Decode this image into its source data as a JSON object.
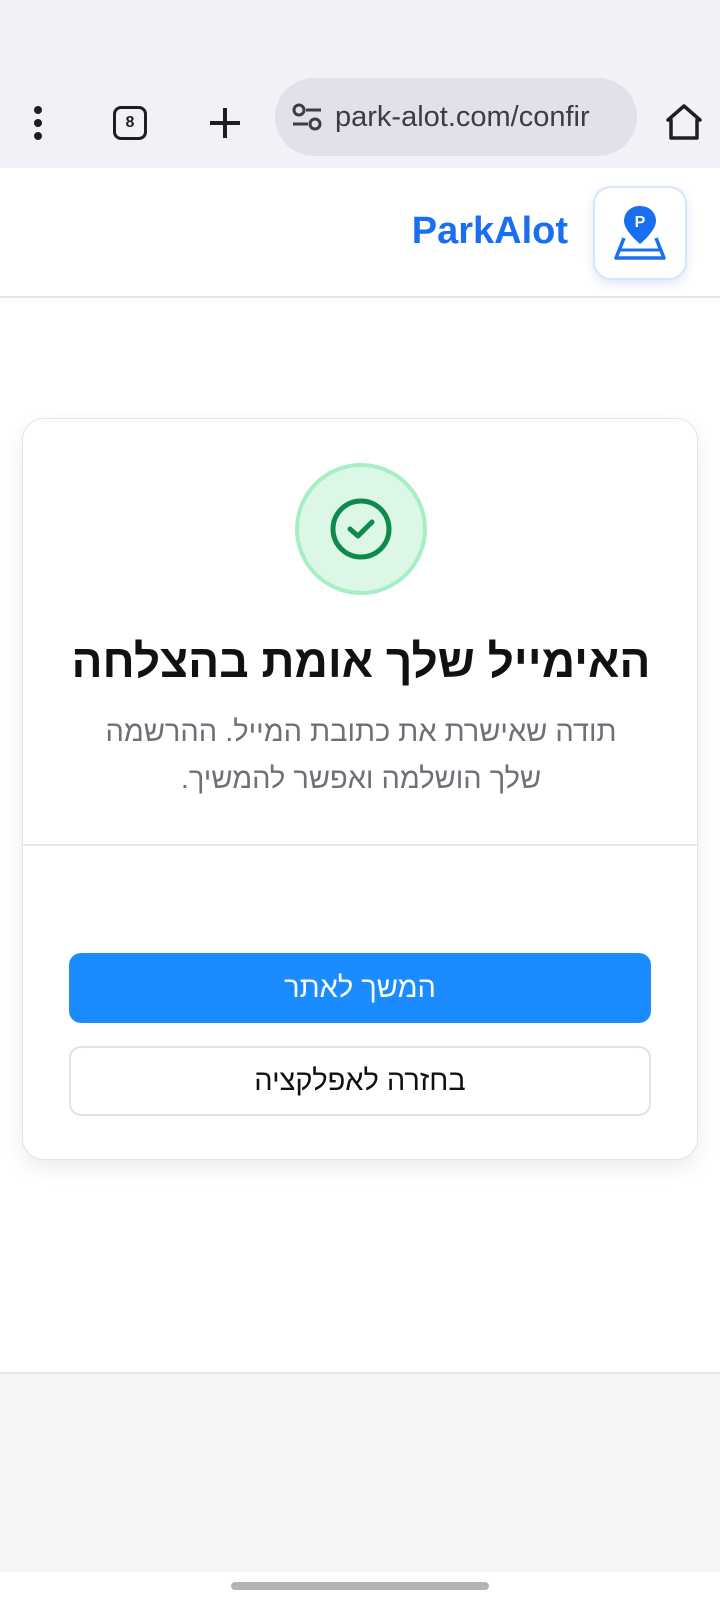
{
  "browser": {
    "tab_count": "8",
    "url": "park-alot.com/confir"
  },
  "site": {
    "brand_name": "ParkAlot",
    "logo_letter": "P"
  },
  "card": {
    "title": "האימייל שלך אומת בהצלחה",
    "subtitle_line1": "תודה שאישרת את כתובת המייל. ההרשמה",
    "subtitle_line2": "שלך הושלמה ואפשר להמשיך.",
    "continue_button": "המשך לאתר",
    "back_button": "בחזרה לאפלקציה"
  },
  "colors": {
    "brand": "#1a6ff0",
    "primary_button": "#1a8cff",
    "success": "#0e8a4e",
    "success_bg": "#dcf7e6"
  }
}
